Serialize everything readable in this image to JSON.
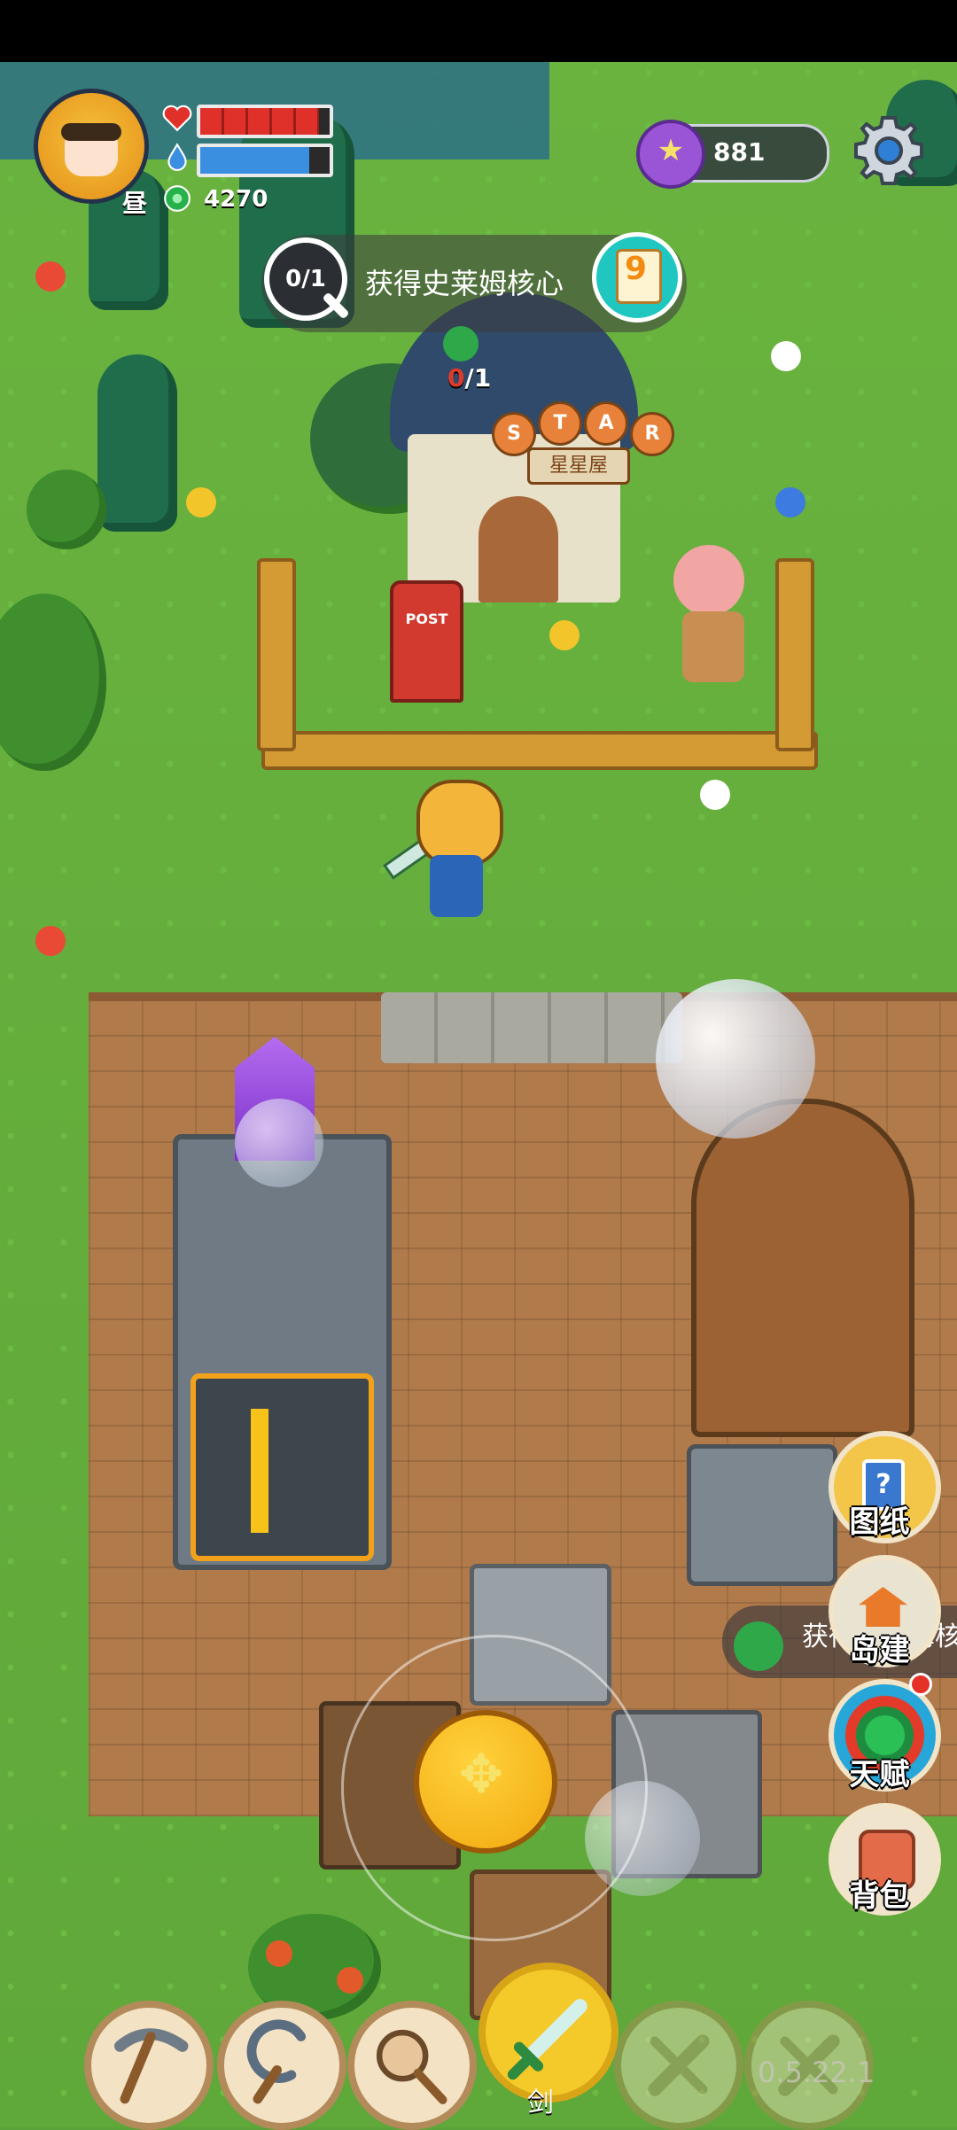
{
  "player": {
    "time_of_day": "昼",
    "hp_fraction": 0.92,
    "mp_fraction": 0.84,
    "gems": "4270"
  },
  "currency": {
    "value": "881",
    "icon": "purple-star-coin-icon"
  },
  "settings": {
    "icon": "gear-icon"
  },
  "quest": {
    "progress": "0/1",
    "title": "获得史莱姆核心",
    "item_count_current": "0",
    "item_count_total": "/1"
  },
  "shop_sign": {
    "letters": [
      "S",
      "T",
      "A",
      "R"
    ],
    "board": "星星屋"
  },
  "post_box_label": "POST",
  "side_menu": [
    {
      "label": "图纸",
      "icon": "blueprint-icon"
    },
    {
      "label": "岛建",
      "icon": "house-icon"
    },
    {
      "label": "天赋",
      "icon": "talent-icon",
      "has_notification": true
    },
    {
      "label": "背包",
      "icon": "backpack-icon"
    }
  ],
  "side_quest_text": "获得史莱姆核",
  "toolbar": {
    "slots": [
      {
        "name": "pickaxe",
        "icon": "pickaxe-icon",
        "enabled": true
      },
      {
        "name": "sickle",
        "icon": "sickle-icon",
        "enabled": true
      },
      {
        "name": "net",
        "icon": "bug-net-icon",
        "enabled": true
      },
      {
        "name": "sword",
        "icon": "sword-icon",
        "enabled": true,
        "selected": true,
        "label": "剑"
      },
      {
        "name": "locked-1",
        "icon": "locked-slot-icon",
        "enabled": false
      },
      {
        "name": "locked-2",
        "icon": "locked-slot-icon",
        "enabled": false
      }
    ]
  },
  "version": "0.5.22.1",
  "colors": {
    "hp": "#e0302a",
    "mp": "#3b8fe0",
    "gem": "#27b14a",
    "coin": "#9a54d6",
    "joystick": "#f2a80e"
  }
}
